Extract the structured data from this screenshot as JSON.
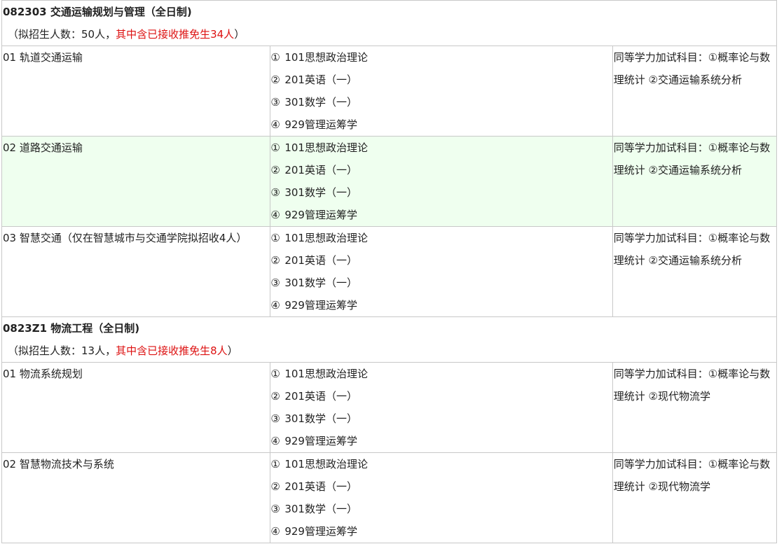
{
  "programs": [
    {
      "title": "082303 交通运输规划与管理（全日制)",
      "quota_prefix": "（拟招生人数：50人，",
      "quota_red": "其中含已接收推免生34人",
      "quota_suffix": "）",
      "directions": [
        {
          "name": "01 轨道交通运输",
          "highlight": false,
          "subjects": [
            {
              "mark": "①",
              "text": "101思想政治理论"
            },
            {
              "mark": "②",
              "text": "201英语（一）"
            },
            {
              "mark": "③",
              "text": "301数学（一）"
            },
            {
              "mark": "④",
              "text": "929管理运筹学"
            }
          ],
          "extra": "同等学力加试科目：①概率论与数理统计 ②交通运输系统分析"
        },
        {
          "name": "02 道路交通运输",
          "highlight": true,
          "subjects": [
            {
              "mark": "①",
              "text": "101思想政治理论"
            },
            {
              "mark": "②",
              "text": "201英语（一）"
            },
            {
              "mark": "③",
              "text": "301数学（一）"
            },
            {
              "mark": "④",
              "text": "929管理运筹学"
            }
          ],
          "extra": "同等学力加试科目：①概率论与数理统计 ②交通运输系统分析"
        },
        {
          "name": "03 智慧交通（仅在智慧城市与交通学院拟招收4人）",
          "highlight": false,
          "subjects": [
            {
              "mark": "①",
              "text": "101思想政治理论"
            },
            {
              "mark": "②",
              "text": "201英语（一）"
            },
            {
              "mark": "③",
              "text": "301数学（一）"
            },
            {
              "mark": "④",
              "text": "929管理运筹学"
            }
          ],
          "extra": "同等学力加试科目：①概率论与数理统计 ②交通运输系统分析"
        }
      ]
    },
    {
      "title": "0823Z1 物流工程（全日制)",
      "quota_prefix": "（拟招生人数：13人，",
      "quota_red": "其中含已接收推免生8人",
      "quota_suffix": "）",
      "directions": [
        {
          "name": "01 物流系统规划",
          "highlight": false,
          "subjects": [
            {
              "mark": "①",
              "text": "101思想政治理论"
            },
            {
              "mark": "②",
              "text": "201英语（一）"
            },
            {
              "mark": "③",
              "text": "301数学（一）"
            },
            {
              "mark": "④",
              "text": "929管理运筹学"
            }
          ],
          "extra": "同等学力加试科目：①概率论与数理统计 ②现代物流学"
        },
        {
          "name": "02 智慧物流技术与系统",
          "highlight": false,
          "subjects": [
            {
              "mark": "①",
              "text": "101思想政治理论"
            },
            {
              "mark": "②",
              "text": "201英语（一）"
            },
            {
              "mark": "③",
              "text": "301数学（一）"
            },
            {
              "mark": "④",
              "text": "929管理运筹学"
            }
          ],
          "extra": "同等学力加试科目：①概率论与数理统计 ②现代物流学"
        }
      ]
    }
  ]
}
